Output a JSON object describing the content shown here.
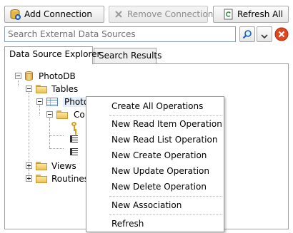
{
  "toolbar": {
    "add_connection": "Add Connection",
    "remove_connection": "Remove Connection",
    "refresh_all": "Refresh All"
  },
  "search": {
    "placeholder": "Search External Data Sources",
    "search_icon": "magnifier-icon",
    "dropdown_icon": "chevron-down-icon",
    "clear_icon": "close-icon"
  },
  "tabs": [
    {
      "label": "Data Source Explorer",
      "active": true
    },
    {
      "label": "Search Results",
      "active": false
    }
  ],
  "tree": {
    "root": "PhotoDB",
    "tables": "Tables",
    "table_item": "Photo",
    "columns_folder": "Co",
    "views": "Views",
    "routines": "Routines"
  },
  "context_menu": {
    "items": [
      "Create All Operations",
      "New Read Item Operation",
      "New Read List Operation",
      "New Create Operation",
      "New Update Operation",
      "New Delete Operation",
      "New Association",
      "Refresh"
    ]
  },
  "colors": {
    "clear_button": "#e0461f",
    "accent_border": "#8da0bd"
  }
}
